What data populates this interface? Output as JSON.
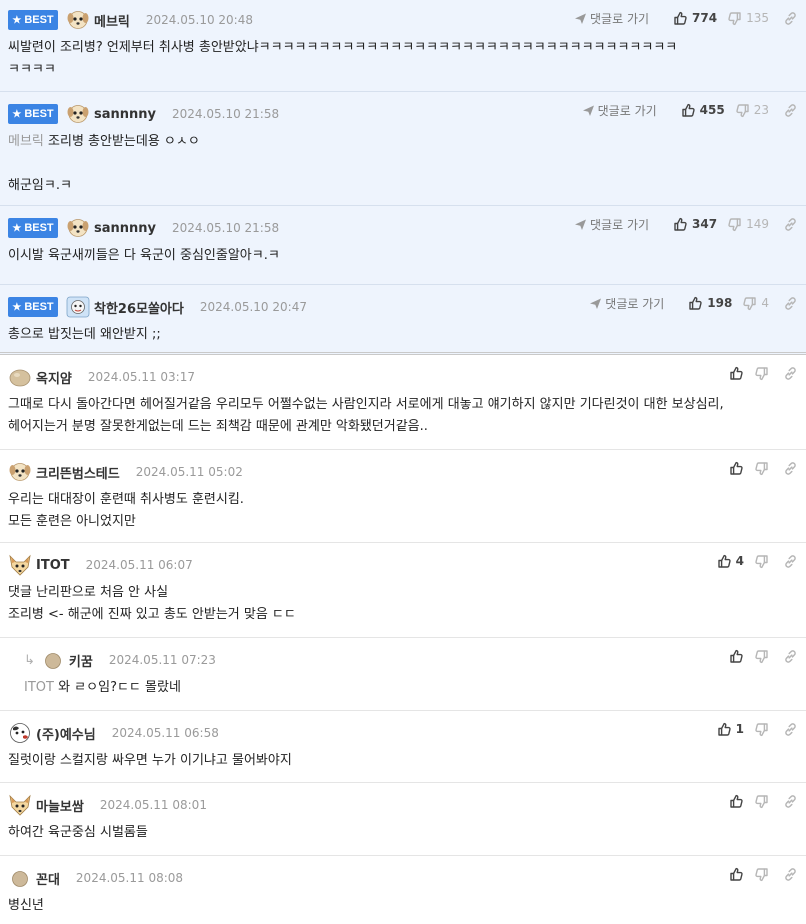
{
  "labels": {
    "best": "BEST",
    "reply_to": "댓글로 가기"
  },
  "colors": {
    "accent": "#3b84e4",
    "best_bg": "#eef4fd",
    "muted": "#9a9a9a"
  },
  "best": [
    {
      "nick": "메브릭",
      "date": "2024.05.10 20:48",
      "up": "774",
      "down": "135",
      "line1": "씨발련이 조리병? 언제부터 취사병 총안받았냐ㅋㅋㅋㅋㅋㅋㅋㅋㅋㅋㅋㅋㅋㅋㅋㅋㅋㅋㅋㅋㅋㅋㅋㅋㅋㅋㅋㅋㅋㅋㅋㅋㅋㅋㅋ",
      "line2": "ㅋㅋㅋㅋ"
    },
    {
      "nick": "sannnny",
      "date": "2024.05.10 21:58",
      "up": "455",
      "down": "23",
      "mention": "메브릭",
      "line1": "조리병 총안받는데용 ㅇㅅㅇ",
      "line2": "해군임ㅋ.ㅋ"
    },
    {
      "nick": "sannnny",
      "date": "2024.05.10 21:58",
      "up": "347",
      "down": "149",
      "line1": "이시발 육군새끼들은 다 육군이 중심인줄알아ㅋ.ㅋ"
    },
    {
      "nick": "착한26모쏠아다",
      "date": "2024.05.10 20:47",
      "up": "198",
      "down": "4",
      "line1": "총으로 밥짓는데 왜안받지 ;;"
    }
  ],
  "comments": [
    {
      "nick": "옥지얌",
      "date": "2024.05.11 03:17",
      "up": "",
      "line1": "그때로 다시 돌아간다면 헤어질거같음 우리모두 어쩔수없는 사람인지라 서로에게 대놓고 얘기하지 않지만 기다린것이 대한 보상심리,",
      "line2": "헤어지는거 분명 잘못한게없는데 드는 죄책감 때문에 관계만 악화됐던거같음.."
    },
    {
      "nick": "크리뜬범스테드",
      "date": "2024.05.11 05:02",
      "up": "",
      "line1": "우리는 대대장이 훈련때 취사병도 훈련시킴.",
      "line2": "모든 훈련은 아니었지만"
    },
    {
      "nick": "ITOT",
      "date": "2024.05.11 06:07",
      "up": "4",
      "line1": "댓글 난리판으로 처음 안 사실",
      "line2": "조리병 <- 해군에 진짜 있고 총도 안받는거 맞음 ㄷㄷ"
    },
    {
      "nick": "키꿈",
      "date": "2024.05.11 07:23",
      "up": "",
      "mention": "ITOT",
      "line1": "와 ㄹㅇ임?ㄷㄷ 몰랐네"
    },
    {
      "nick": "(주)예수님",
      "date": "2024.05.11 06:58",
      "up": "1",
      "line1": "질럿이랑 스컬지랑 싸우면 누가 이기냐고 물어봐야지"
    },
    {
      "nick": "마늘보쌈",
      "date": "2024.05.11 08:01",
      "up": "",
      "line1": "하여간 육군중심 시벌롬들"
    },
    {
      "nick": "꼰대",
      "date": "2024.05.11 08:08",
      "up": "",
      "line1": "병신년"
    }
  ]
}
